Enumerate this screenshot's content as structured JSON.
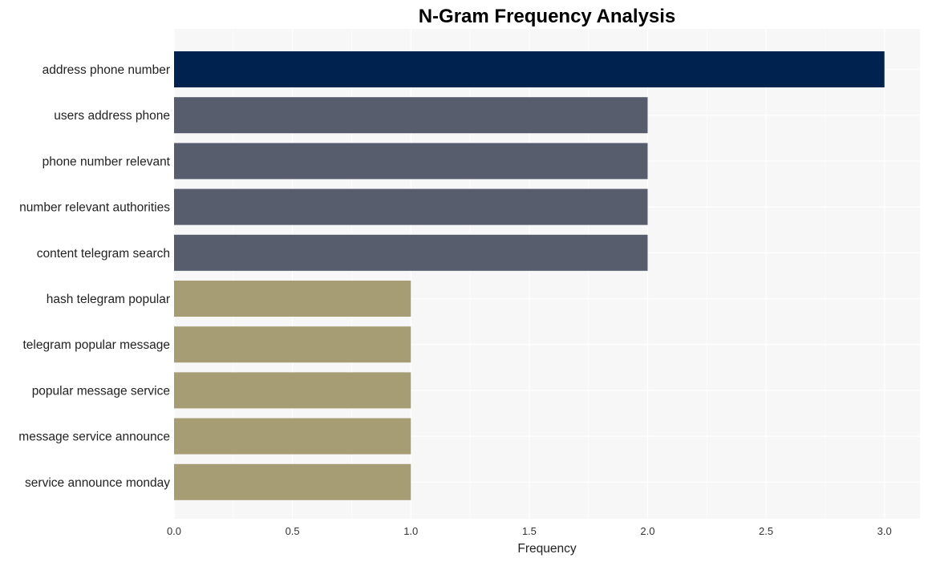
{
  "chart_data": {
    "type": "bar",
    "orientation": "horizontal",
    "title": "N-Gram Frequency Analysis",
    "xlabel": "Frequency",
    "ylabel": "",
    "categories": [
      "address phone number",
      "users address phone",
      "phone number relevant",
      "number relevant authorities",
      "content telegram search",
      "hash telegram popular",
      "telegram popular message",
      "popular message service",
      "message service announce",
      "service announce monday"
    ],
    "values": [
      3,
      2,
      2,
      2,
      2,
      1,
      1,
      1,
      1,
      1
    ],
    "bar_colors": [
      "#00224e",
      "#575d6d",
      "#575d6d",
      "#575d6d",
      "#575d6d",
      "#a69d75",
      "#a69d75",
      "#a69d75",
      "#a69d75",
      "#a69d75"
    ],
    "xlim": [
      0,
      3.15
    ],
    "xticks": [
      0.0,
      0.5,
      1.0,
      1.5,
      2.0,
      2.5,
      3.0
    ],
    "xtick_labels": [
      "0.0",
      "0.5",
      "1.0",
      "1.5",
      "2.0",
      "2.5",
      "3.0"
    ],
    "grid": true,
    "legend": "none",
    "background_color": "#f7f7f7"
  }
}
